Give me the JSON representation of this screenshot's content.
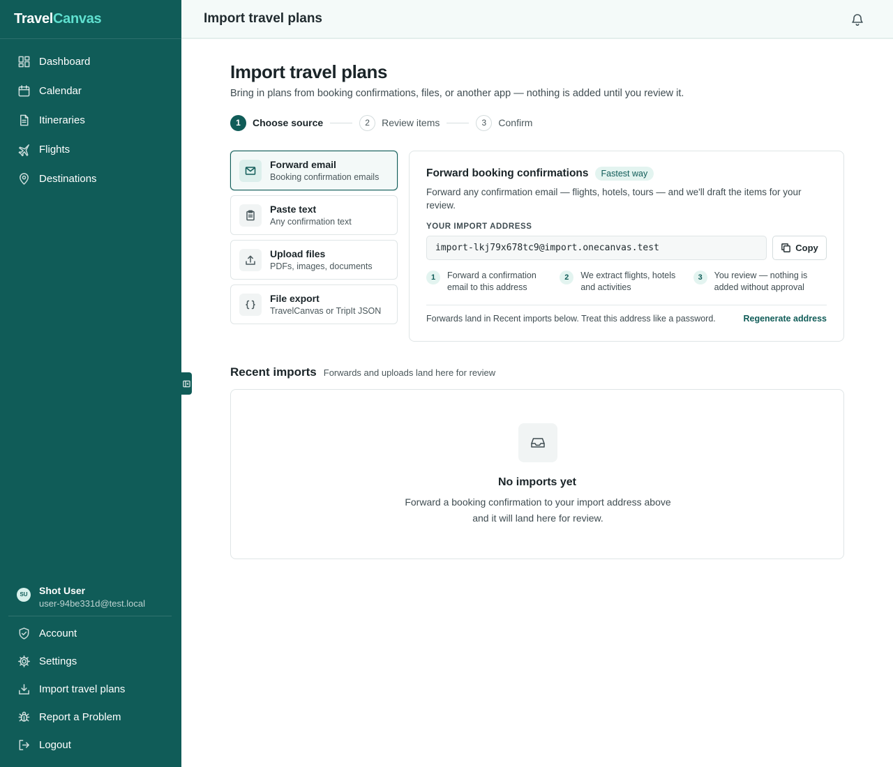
{
  "brand": {
    "part1": "Travel",
    "part2": "Canvas"
  },
  "sidebar": {
    "items": [
      {
        "label": "Dashboard",
        "icon": "dashboard-icon"
      },
      {
        "label": "Calendar",
        "icon": "calendar-icon"
      },
      {
        "label": "Itineraries",
        "icon": "document-icon"
      },
      {
        "label": "Flights",
        "icon": "plane-icon"
      },
      {
        "label": "Destinations",
        "icon": "map-pin-icon"
      }
    ],
    "user": {
      "initials": "SU",
      "name": "Shot User",
      "email": "user-94be331d@test.local"
    },
    "bottom_items": [
      {
        "label": "Account",
        "icon": "shield-icon"
      },
      {
        "label": "Settings",
        "icon": "gear-icon"
      },
      {
        "label": "Import travel plans",
        "icon": "import-icon"
      },
      {
        "label": "Report a Problem",
        "icon": "bug-icon"
      },
      {
        "label": "Logout",
        "icon": "logout-icon"
      }
    ]
  },
  "topbar": {
    "title": "Import travel plans"
  },
  "main": {
    "title": "Import travel plans",
    "subtitle": "Bring in plans from booking confirmations, files, or another app — nothing is added until you review it.",
    "steps": [
      {
        "num": "1",
        "label": "Choose source",
        "active": true
      },
      {
        "num": "2",
        "label": "Review items",
        "active": false
      },
      {
        "num": "3",
        "label": "Confirm",
        "active": false
      }
    ],
    "sources": [
      {
        "title": "Forward email",
        "desc": "Booking confirmation emails",
        "icon": "mail-icon",
        "selected": true
      },
      {
        "title": "Paste text",
        "desc": "Any confirmation text",
        "icon": "clipboard-icon",
        "selected": false
      },
      {
        "title": "Upload files",
        "desc": "PDFs, images, documents",
        "icon": "upload-icon",
        "selected": false
      },
      {
        "title": "File export",
        "desc": "TravelCanvas or TripIt JSON",
        "icon": "braces-icon",
        "selected": false
      }
    ],
    "panel": {
      "title": "Forward booking confirmations",
      "badge": "Fastest way",
      "desc": "Forward any confirmation email — flights, hotels, tours — and we'll draft the items for your review.",
      "address_label": "YOUR IMPORT ADDRESS",
      "address": "import-lkj79x678tc9@import.onecanvas.test",
      "copy_label": "Copy",
      "how": [
        {
          "num": "1",
          "text": "Forward a confirmation email to this address"
        },
        {
          "num": "2",
          "text": "We extract flights, hotels and activities"
        },
        {
          "num": "3",
          "text": "You review — nothing is added without approval"
        }
      ],
      "footer_text": "Forwards land in Recent imports below. Treat this address like a password.",
      "regen_label": "Regenerate address"
    },
    "recent": {
      "title": "Recent imports",
      "subtitle": "Forwards and uploads land here for review",
      "empty_title": "No imports yet",
      "empty_text": "Forward a booking confirmation to your import address above and it will land here for review."
    }
  },
  "colors": {
    "sidebar_bg": "#105c58",
    "accent": "#105c58",
    "brand_accent": "#5fe0cf"
  }
}
